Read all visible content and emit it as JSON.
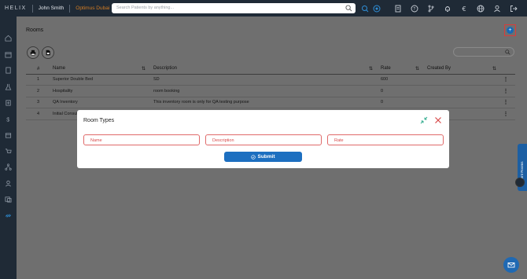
{
  "header": {
    "brand": "HELIX",
    "user_name": "John Smith",
    "clinic_name": "Optimus Dubai",
    "search_placeholder": "Search Patients by anything...",
    "icons": [
      "search-icon",
      "grid-icon",
      "brain-icon",
      "notes-icon",
      "help-icon",
      "branch-icon",
      "bell-icon",
      "euro-icon",
      "globe-icon",
      "user-icon",
      "logout-icon"
    ]
  },
  "sidebar": {
    "icons": [
      "home-icon",
      "calendar-icon",
      "document-icon",
      "lab-flask-icon",
      "pharmacy-icon",
      "billing-dollar-icon",
      "inventory-box-icon",
      "cart-icon",
      "network-icon",
      "staff-icon",
      "reports-icon",
      "active-link-icon"
    ]
  },
  "page": {
    "title": "Rooms",
    "add_icon": "+",
    "toolbar": [
      "print-icon",
      "export-file-icon"
    ]
  },
  "table": {
    "columns": [
      "#",
      "Name",
      "Description",
      "Rate",
      "Created By"
    ],
    "rows": [
      {
        "num": "1",
        "name": "Superior Double Bed",
        "description": "SD",
        "rate": "600",
        "created_by": ""
      },
      {
        "num": "2",
        "name": "Hospitality",
        "description": "room booking",
        "rate": "0",
        "created_by": ""
      },
      {
        "num": "3",
        "name": "QA Inventory",
        "description": "This inventory room is only for QA testing purpose",
        "rate": "0",
        "created_by": ""
      },
      {
        "num": "4",
        "name": "Initial Consul",
        "description": "",
        "rate": "",
        "created_by": ""
      }
    ]
  },
  "modal": {
    "title": "Room Types",
    "fields": {
      "name_placeholder": "Name",
      "description_placeholder": "Description",
      "rate_placeholder": "Rate"
    },
    "submit_label": "Submit"
  },
  "right_tab": {
    "label": "Patient Rooms"
  },
  "colors": {
    "accent": "#1d6fc0",
    "error": "#d84b4b",
    "dark": "#1f2a36",
    "clinic": "#d47d23"
  }
}
